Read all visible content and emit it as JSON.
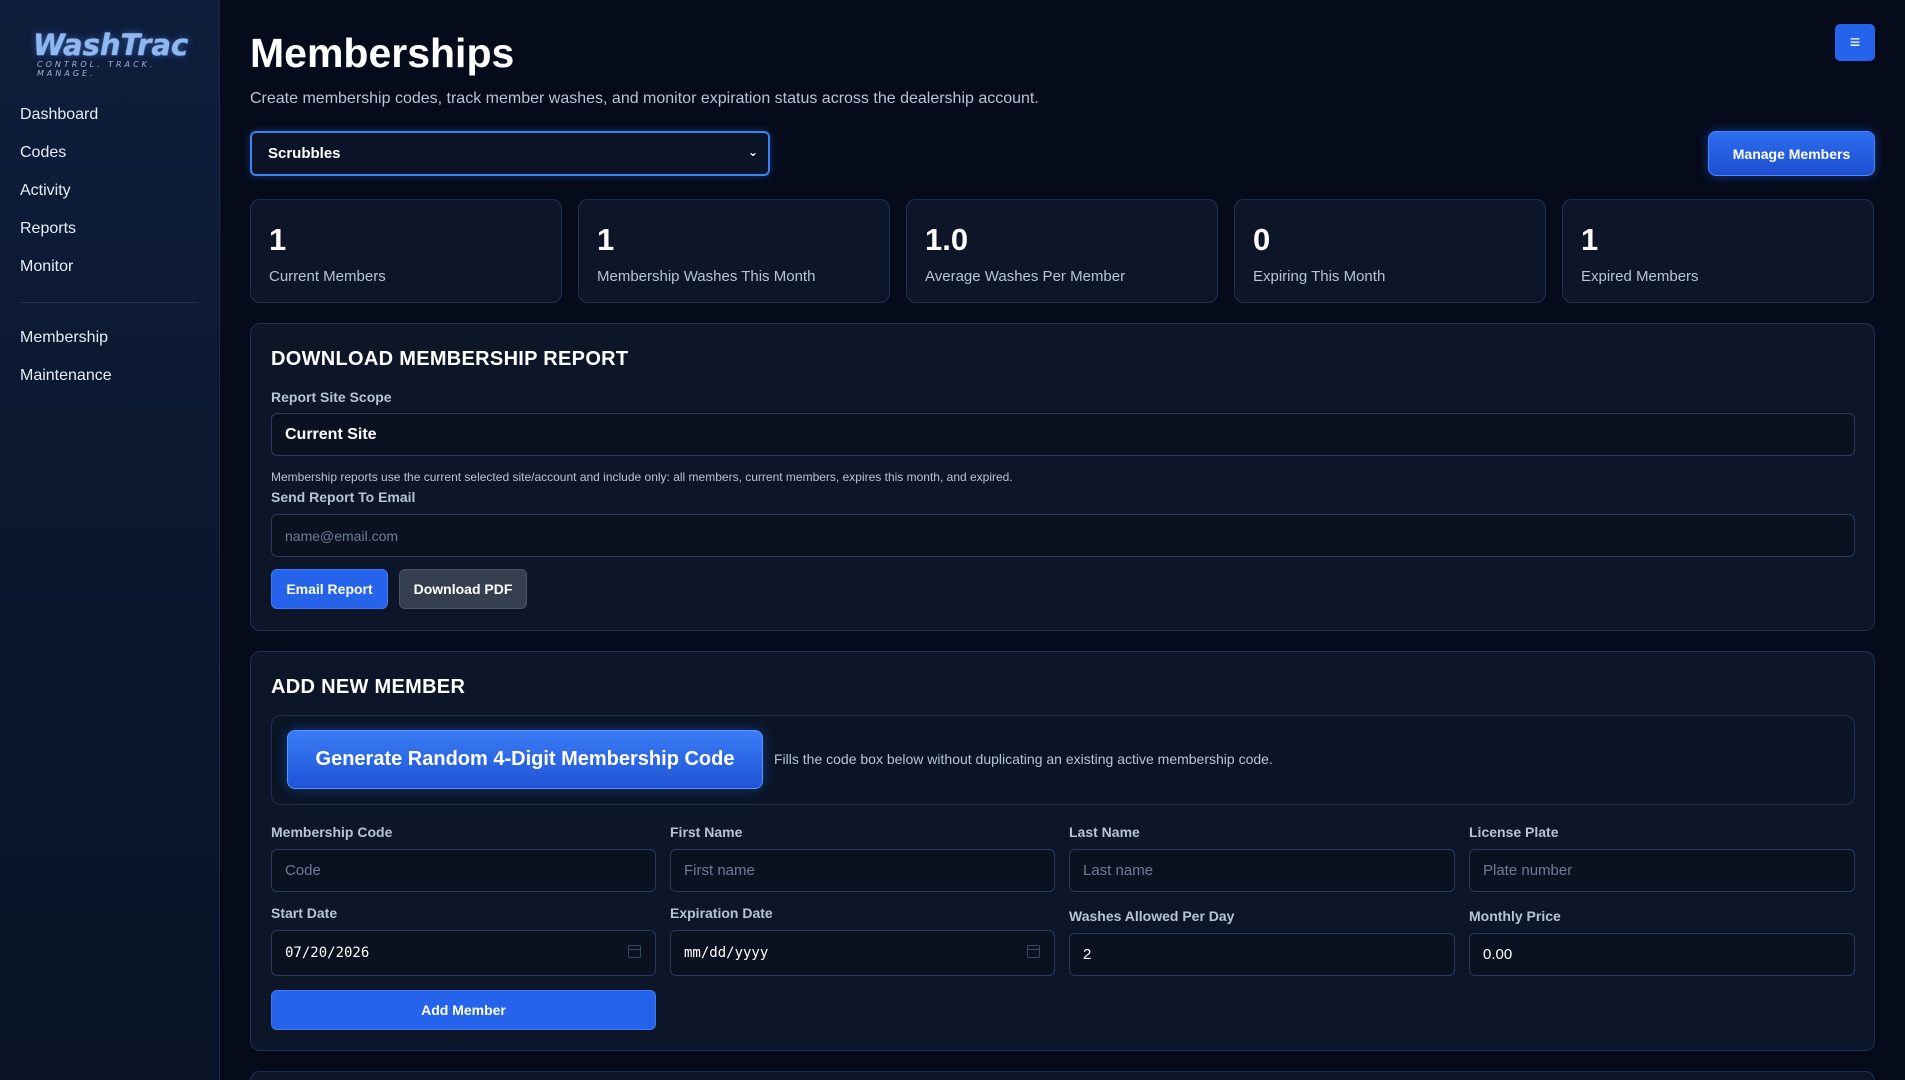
{
  "brand": {
    "logo_text": "WashTrac",
    "tagline": "CONTROL. TRACK. MANAGE."
  },
  "sidebar": {
    "items": [
      {
        "label": "Dashboard"
      },
      {
        "label": "Codes"
      },
      {
        "label": "Activity"
      },
      {
        "label": "Reports"
      },
      {
        "label": "Monitor"
      }
    ],
    "secondary_items": [
      {
        "label": "Membership"
      },
      {
        "label": "Maintenance"
      }
    ]
  },
  "header": {
    "title": "Memberships",
    "subtitle": "Create membership codes, track member washes, and monitor expiration status across the dealership account.",
    "menu_icon": "≡"
  },
  "site_selector": {
    "value": "Scrubbles"
  },
  "manage_button": {
    "label": "Manage Members"
  },
  "stats": [
    {
      "value": "1",
      "label": "Current Members"
    },
    {
      "value": "1",
      "label": "Membership Washes This Month"
    },
    {
      "value": "1.0",
      "label": "Average Washes Per Member"
    },
    {
      "value": "0",
      "label": "Expiring This Month"
    },
    {
      "value": "1",
      "label": "Expired Members"
    }
  ],
  "report": {
    "title": "DOWNLOAD MEMBERSHIP REPORT",
    "scope_label": "Report Site Scope",
    "scope_value": "Current Site",
    "scope_note": "Membership reports use the current selected site/account and include only: all members, current members, expires this month, and expired.",
    "email_label": "Send Report To Email",
    "email_placeholder": "name@email.com",
    "email_button": "Email Report",
    "pdf_button": "Download PDF"
  },
  "add_member": {
    "title": "ADD NEW MEMBER",
    "generate_button": "Generate Random 4-Digit Membership Code",
    "generate_helper": "Fills the code box below without duplicating an existing active membership code.",
    "fields": {
      "code_label": "Membership Code",
      "code_placeholder": "Code",
      "first_label": "First Name",
      "first_placeholder": "First name",
      "last_label": "Last Name",
      "last_placeholder": "Last name",
      "plate_label": "License Plate",
      "plate_placeholder": "Plate number",
      "start_label": "Start Date",
      "start_value": "07/20/2026",
      "exp_label": "Expiration Date",
      "exp_value": "mm/dd/yyyy",
      "washes_label": "Washes Allowed Per Day",
      "washes_value": "2",
      "price_label": "Monthly Price",
      "price_value": "0.00"
    },
    "submit_button": "Add Member"
  }
}
